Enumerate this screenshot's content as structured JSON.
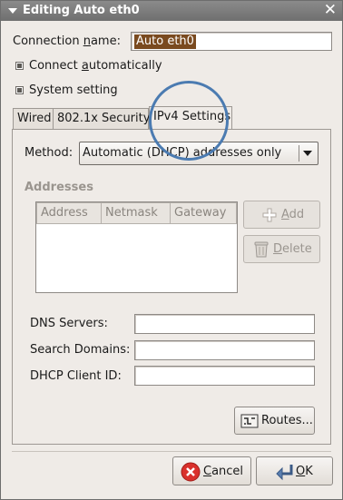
{
  "window": {
    "title": "Editing Auto eth0"
  },
  "connection": {
    "name_label": "Connection name:",
    "name_value": "Auto eth0"
  },
  "checkboxes": [
    {
      "label": "Connect automatically",
      "checked": true
    },
    {
      "label": "System setting",
      "checked": true
    }
  ],
  "tabs": [
    {
      "label": "Wired",
      "active": false
    },
    {
      "label": "802.1x Security",
      "active": false
    },
    {
      "label": "IPv4 Settings",
      "active": true
    }
  ],
  "ipv4": {
    "method_label": "Method:",
    "method_value": "Automatic (DHCP) addresses only",
    "addresses_label": "Addresses",
    "columns": [
      "Address",
      "Netmask",
      "Gateway"
    ],
    "add_label": "Add",
    "delete_label": "Delete",
    "dns_label": "DNS Servers:",
    "dns_value": "",
    "search_label": "Search Domains:",
    "search_value": "",
    "dhcp_label": "DHCP Client ID:",
    "dhcp_value": "",
    "routes_label": "Routes..."
  },
  "footer": {
    "cancel_label": "Cancel",
    "ok_label": "OK"
  },
  "colors": {
    "titlebar": "#7a7a7a",
    "selection": "#7a4a1f",
    "highlight_ring": "#4b7bb1",
    "cancel_icon": "#d9302c"
  },
  "icons": [
    "menu-arrow-icon",
    "close-icon",
    "plus-icon",
    "trash-icon",
    "routes-icon",
    "cancel-icon",
    "ok-return-icon"
  ]
}
